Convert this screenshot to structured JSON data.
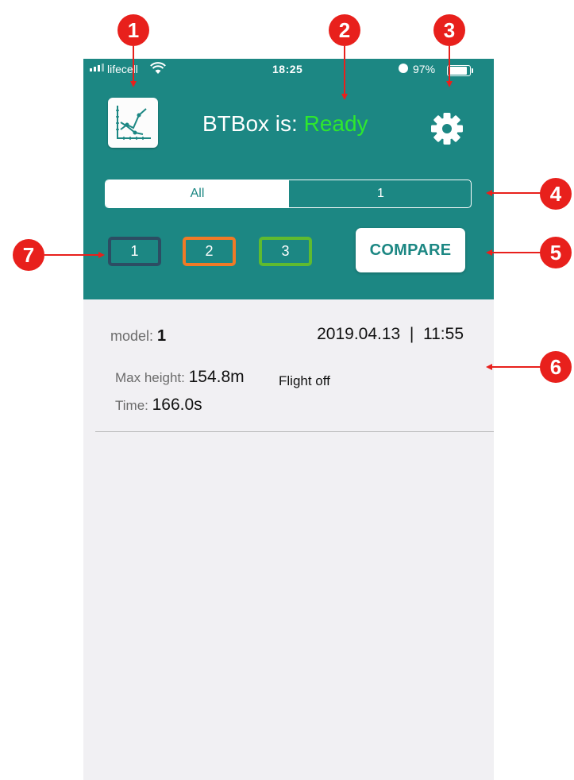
{
  "status_bar": {
    "carrier": "lifecell",
    "time": "18:25",
    "battery": "97%",
    "battery_level": 0.97
  },
  "header": {
    "title_prefix": "BTBox is:",
    "status": "Ready",
    "status_color": "#2ee82e",
    "bg_color": "#1c8783"
  },
  "segments": [
    {
      "label": "All",
      "selected": true
    },
    {
      "label": "1",
      "selected": false
    }
  ],
  "models": [
    {
      "label": "1",
      "color": "#2c4d63"
    },
    {
      "label": "2",
      "color": "#f07a26"
    },
    {
      "label": "3",
      "color": "#5fbb2f"
    }
  ],
  "compare_label": "COMPARE",
  "record": {
    "model_label": "model:",
    "model_value": "1",
    "date": "2019.04.13  |  11:55",
    "max_height_label": "Max height:",
    "max_height_value": "154.8m",
    "flight_text": "Flight off",
    "time_label": "Time:",
    "time_value": "166.0s"
  },
  "annotations": [
    "1",
    "2",
    "3",
    "4",
    "5",
    "6",
    "7"
  ],
  "annotation_color": "#e8201c"
}
